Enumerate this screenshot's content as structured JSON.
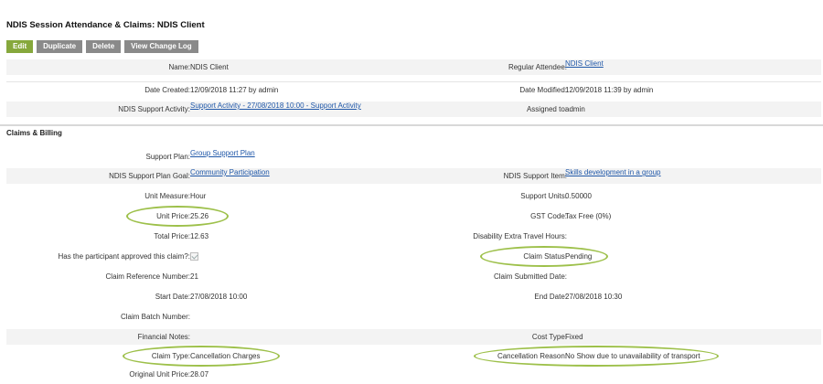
{
  "page": {
    "title": "NDIS Session Attendance & Claims: NDIS Client"
  },
  "toolbar": {
    "edit": "Edit",
    "duplicate": "Duplicate",
    "delete": "Delete",
    "history": "View Change Log"
  },
  "header_fields": {
    "name": {
      "label": "Name:",
      "value": "NDIS Client"
    },
    "regular_attendee": {
      "label": "Regular Attendee:",
      "value": "NDIS Client"
    },
    "date_created": {
      "label": "Date Created:",
      "value": "12/09/2018 11:27 by admin"
    },
    "date_modified": {
      "label": "Date Modified:",
      "value": "12/09/2018 11:39 by admin"
    },
    "support_activity": {
      "label": "NDIS Support Activity:",
      "value": "Support Activity - 27/08/2018 10:00 - Support Activity"
    },
    "assigned_to": {
      "label": "Assigned to:",
      "value": "admin"
    }
  },
  "section": {
    "title": "Claims & Billing"
  },
  "claims": {
    "support_plan": {
      "label": "Support Plan:",
      "value": "Group Support Plan"
    },
    "support_plan_goal": {
      "label": "NDIS Support Plan Goal:",
      "value": "Community Participation"
    },
    "support_item": {
      "label": "NDIS Support Item:",
      "value": "Skills development in a group"
    },
    "unit_measure": {
      "label": "Unit Measure:",
      "value": "Hour"
    },
    "support_units": {
      "label": "Support Units:",
      "value": "0.50000"
    },
    "unit_price": {
      "label": "Unit Price:",
      "value": "25.26"
    },
    "gst_code": {
      "label": "GST Code:",
      "value": "Tax Free (0%)"
    },
    "total_price": {
      "label": "Total Price:",
      "value": "12.63"
    },
    "disability_travel": {
      "label": "Disability Extra Travel Hours:",
      "value": ""
    },
    "approved": {
      "label": "Has the participant approved this claim?:",
      "checked": true
    },
    "claim_status": {
      "label": "Claim Status:",
      "value": "Pending"
    },
    "claim_reference": {
      "label": "Claim Reference Number:",
      "value": "21"
    },
    "claim_submitted": {
      "label": "Claim Submitted Date:",
      "value": ""
    },
    "start_date": {
      "label": "Start Date:",
      "value": "27/08/2018 10:00"
    },
    "end_date": {
      "label": "End Date:",
      "value": "27/08/2018 10:30"
    },
    "batch_number": {
      "label": "Claim Batch Number:",
      "value": ""
    },
    "financial_notes": {
      "label": "Financial Notes:",
      "value": ""
    },
    "cost_type": {
      "label": "Cost Type:",
      "value": "Fixed"
    },
    "claim_type": {
      "label": "Claim Type:",
      "value": "Cancellation Charges"
    },
    "cancellation_reason": {
      "label": "Cancellation Reason:",
      "value": "No Show due to unavailability of transport"
    },
    "original_unit_price": {
      "label": "Original Unit Price:",
      "value": "28.07"
    }
  },
  "colors": {
    "accent": "#86a83c",
    "highlight": "#9dc04a",
    "link": "#1f57a8",
    "button_gray": "#8a8a8a"
  }
}
